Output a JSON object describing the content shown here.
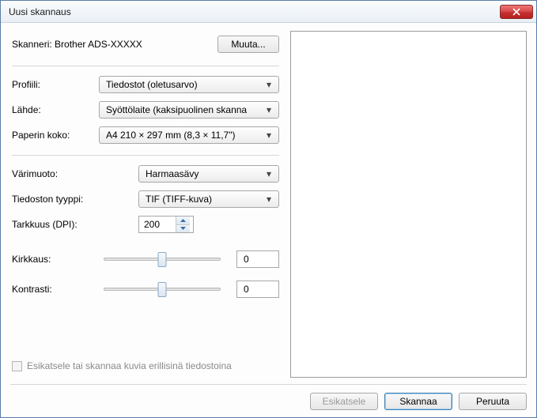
{
  "window": {
    "title": "Uusi skannaus"
  },
  "scanner": {
    "label_prefix": "Skanneri:",
    "name": "Brother ADS-XXXXX",
    "change_btn": "Muuta..."
  },
  "profile": {
    "label": "Profiili:",
    "value": "Tiedostot (oletusarvo)"
  },
  "source": {
    "label": "Lähde:",
    "value": "Syöttölaite (kaksipuolinen skanna"
  },
  "paper": {
    "label": "Paperin koko:",
    "value": "A4 210 × 297 mm (8,3 × 11,7\")"
  },
  "color": {
    "label": "Värimuoto:",
    "value": "Harmaasävy"
  },
  "filetype": {
    "label": "Tiedoston tyyppi:",
    "value": "TIF (TIFF-kuva)"
  },
  "dpi": {
    "label": "Tarkkuus (DPI):",
    "value": "200"
  },
  "brightness": {
    "label": "Kirkkaus:",
    "value": "0"
  },
  "contrast": {
    "label": "Kontrasti:",
    "value": "0"
  },
  "checkbox": {
    "label": "Esikatsele tai skannaa kuvia erillisinä tiedostoina"
  },
  "footer": {
    "preview": "Esikatsele",
    "scan": "Skannaa",
    "cancel": "Peruuta"
  }
}
